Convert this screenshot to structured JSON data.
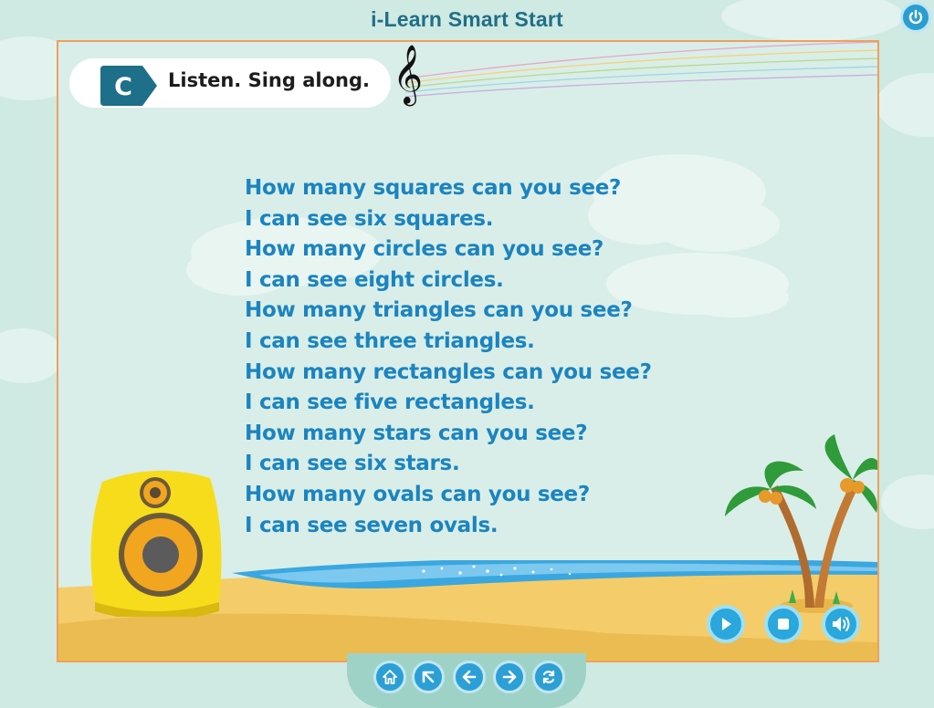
{
  "app": {
    "title": "i-Learn Smart Start"
  },
  "header": {
    "badge_letter": "C",
    "instruction": "Listen. Sing along."
  },
  "lyrics": [
    "How many squares can you see?",
    "I can see six squares.",
    "How many circles can you see?",
    "I can see eight circles.",
    "How many triangles can you see?",
    "I can see three triangles.",
    "How many rectangles can you see?",
    "I can see five rectangles.",
    "How many stars can you see?",
    "I can see six stars.",
    "How many ovals can you see?",
    "I can see seven ovals."
  ],
  "media_controls": [
    {
      "icon": "play-icon"
    },
    {
      "icon": "stop-icon"
    },
    {
      "icon": "volume-icon"
    }
  ],
  "nav_buttons": [
    {
      "icon": "home-icon"
    },
    {
      "icon": "menu-up-icon"
    },
    {
      "icon": "arrow-left-icon"
    },
    {
      "icon": "arrow-right-icon"
    },
    {
      "icon": "refresh-icon"
    }
  ],
  "colors": {
    "background": "#cfe9e3",
    "title_text": "#1f6f86",
    "lyrics_text": "#1b84c0",
    "frame_border": "#f0a05a",
    "badge": "#1e6f8a",
    "button_blue": "#2aa7dc",
    "speaker_yellow": "#f7dc1b",
    "speaker_orange": "#f2a51f"
  }
}
